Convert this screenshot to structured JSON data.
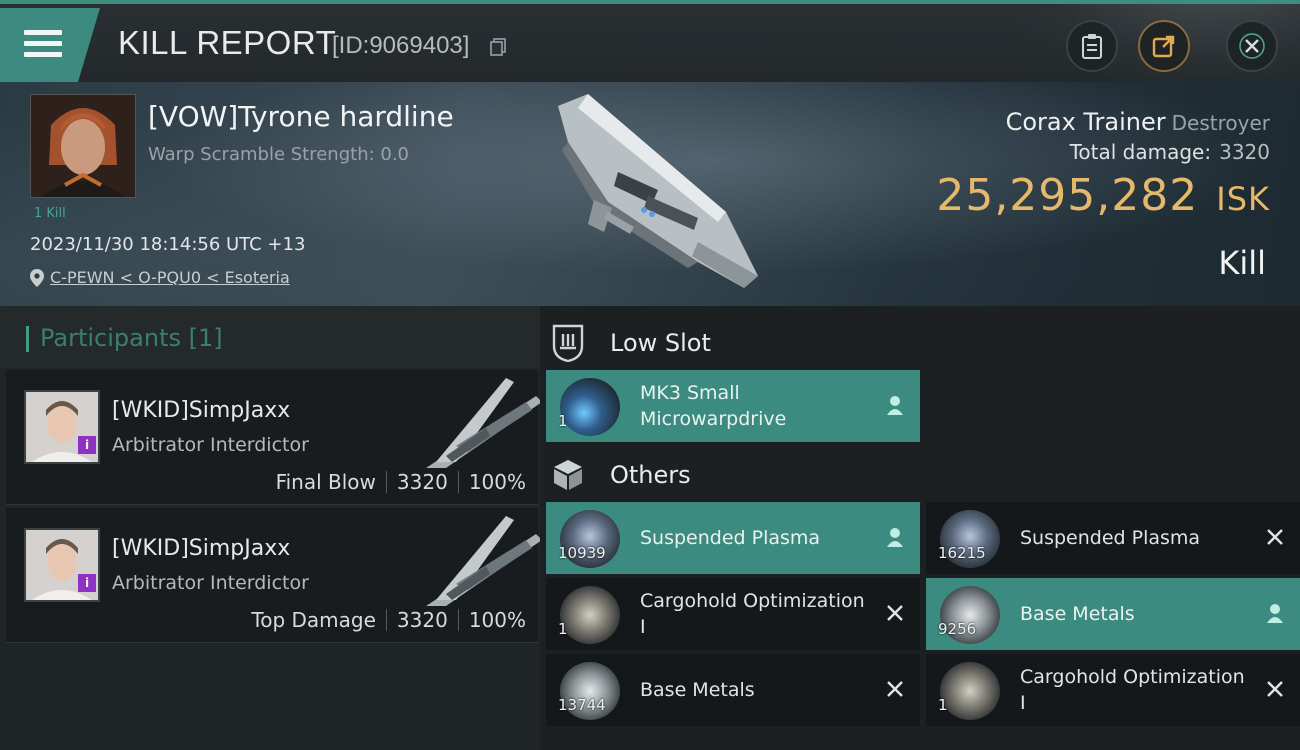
{
  "header": {
    "title": "KILL REPORT",
    "report_id": "[ID:9069403]"
  },
  "victim": {
    "name": "[VOW]Tyrone hardline",
    "warp_scramble": "Warp Scramble Strength: 0.0",
    "kill_count": "1 Kill",
    "datetime": "2023/11/30 18:14:56 UTC +13",
    "location": "C-PEWN < O-PQU0 < Esoteria",
    "ship_name": "Corax Trainer",
    "ship_class": "Destroyer",
    "total_damage_label": "Total damage:",
    "total_damage": "3320",
    "isk_value": "25,295,282",
    "isk_unit": "ISK",
    "result": "Kill"
  },
  "participants": {
    "title": "Participants [1]",
    "rows": [
      {
        "name": "[WKID]SimpJaxx",
        "ship": "Arbitrator Interdictor",
        "role": "Final Blow",
        "damage": "3320",
        "percent": "100%",
        "badge": "i"
      },
      {
        "name": "[WKID]SimpJaxx",
        "ship": "Arbitrator Interdictor",
        "role": "Top Damage",
        "damage": "3320",
        "percent": "100%",
        "badge": "i"
      }
    ]
  },
  "items": {
    "low_slot_title": "Low Slot",
    "others_title": "Others",
    "low_slot": [
      {
        "name": "MK3 Small Microwarpdrive",
        "qty": "1",
        "status": "dropped"
      }
    ],
    "others": [
      {
        "name": "Suspended Plasma",
        "qty": "10939",
        "status": "dropped"
      },
      {
        "name": "Suspended Plasma",
        "qty": "16215",
        "status": "destroyed"
      },
      {
        "name": "Cargohold Optimization I",
        "qty": "1",
        "status": "destroyed"
      },
      {
        "name": "Base Metals",
        "qty": "9256",
        "status": "dropped"
      },
      {
        "name": "Base Metals",
        "qty": "13744",
        "status": "destroyed"
      },
      {
        "name": "Cargohold Optimization I",
        "qty": "1",
        "status": "destroyed"
      }
    ]
  },
  "colors": {
    "accent": "#3c8b80",
    "isk": "#e6b86b"
  }
}
